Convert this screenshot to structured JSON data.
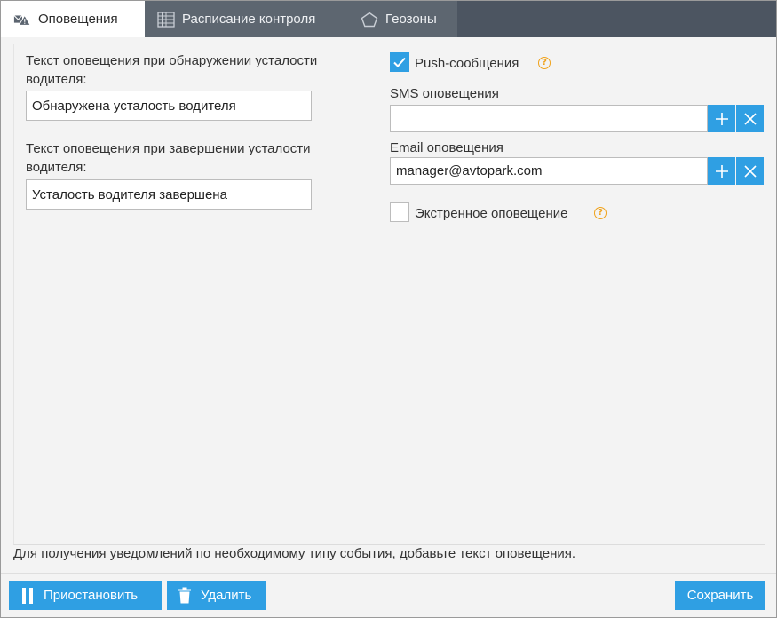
{
  "tabs": [
    {
      "label": "Оповещения",
      "icon": "envelope-warning-icon",
      "active": true
    },
    {
      "label": "Расписание контроля",
      "icon": "calendar-grid-icon",
      "active": false
    },
    {
      "label": "Геозоны",
      "icon": "pentagon-icon",
      "active": false
    }
  ],
  "form": {
    "detect_label": "Текст оповещения при обнаружении усталости водителя:",
    "detect_value": "Обнаружена усталость водителя",
    "end_label": "Текст оповещения при завершении усталости водителя:",
    "end_value": "Усталость водителя завершена",
    "push_label": "Push-сообщения",
    "push_checked": true,
    "sms_label": "SMS оповещения",
    "sms_value": "",
    "email_label": "Email оповещения",
    "email_value": "manager@avtopark.com",
    "emergency_label": "Экстренное оповещение",
    "emergency_checked": false,
    "help_glyph": "?"
  },
  "footer_note": "Для получения уведомлений по необходимому типу события, добавьте текст оповещения.",
  "buttons": {
    "pause": "Приостановить",
    "delete": "Удалить",
    "save": "Сохранить"
  },
  "colors": {
    "accent": "#2f9fe3",
    "tabbar": "#4c5561",
    "help": "#f0a21b"
  }
}
